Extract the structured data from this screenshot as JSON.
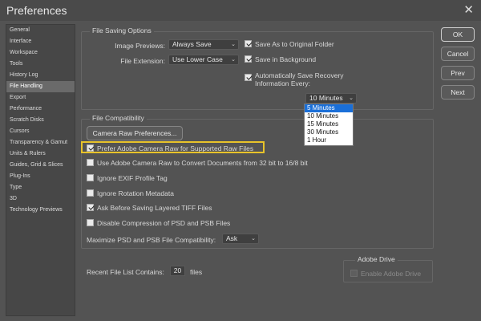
{
  "window": {
    "title": "Preferences",
    "close_glyph": "✕"
  },
  "sidebar": {
    "items": [
      {
        "label": "General"
      },
      {
        "label": "Interface"
      },
      {
        "label": "Workspace"
      },
      {
        "label": "Tools"
      },
      {
        "label": "History Log"
      },
      {
        "label": "File Handling",
        "selected": true
      },
      {
        "label": "Export"
      },
      {
        "label": "Performance"
      },
      {
        "label": "Scratch Disks"
      },
      {
        "label": "Cursors"
      },
      {
        "label": "Transparency & Gamut"
      },
      {
        "label": "Units & Rulers"
      },
      {
        "label": "Guides, Grid & Slices"
      },
      {
        "label": "Plug-Ins"
      },
      {
        "label": "Type"
      },
      {
        "label": "3D"
      },
      {
        "label": "Technology Previews"
      }
    ]
  },
  "file_saving": {
    "title": "File Saving Options",
    "image_previews_label": "Image Previews:",
    "image_previews_value": "Always Save",
    "file_extension_label": "File Extension:",
    "file_extension_value": "Use Lower Case",
    "save_as_original": {
      "label": "Save As to Original Folder",
      "checked": true
    },
    "save_background": {
      "label": "Save in Background",
      "checked": true
    },
    "auto_save": {
      "label_line1": "Automatically Save Recovery",
      "label_line2": "Information Every:",
      "checked": true
    },
    "interval_value": "10 Minutes",
    "interval_options": [
      "5 Minutes",
      "10 Minutes",
      "15 Minutes",
      "30 Minutes",
      "1 Hour"
    ],
    "interval_selected_index": 0
  },
  "file_compat": {
    "title": "File Compatibility",
    "camera_raw_button": "Camera Raw Preferences...",
    "options": [
      {
        "label": "Prefer Adobe Camera Raw for Supported Raw Files",
        "checked": true
      },
      {
        "label": "Use Adobe Camera Raw to Convert Documents from 32 bit to 16/8 bit",
        "checked": false
      },
      {
        "label": "Ignore EXIF Profile Tag",
        "checked": false
      },
      {
        "label": "Ignore Rotation Metadata",
        "checked": false
      },
      {
        "label": "Ask Before Saving Layered TIFF Files",
        "checked": true
      },
      {
        "label": "Disable Compression of PSD and PSB Files",
        "checked": false
      }
    ],
    "maximize_label": "Maximize PSD and PSB File Compatibility:",
    "maximize_value": "Ask"
  },
  "recent_files": {
    "label": "Recent File List Contains:",
    "value": "20",
    "suffix": "files"
  },
  "adobe_drive": {
    "title": "Adobe Drive",
    "enable_label": "Enable Adobe Drive"
  },
  "buttons": {
    "ok": "OK",
    "cancel": "Cancel",
    "prev": "Prev",
    "next": "Next"
  },
  "colors": {
    "highlight": "#e8c32a",
    "dropdown_selected": "#1a6fd8"
  }
}
